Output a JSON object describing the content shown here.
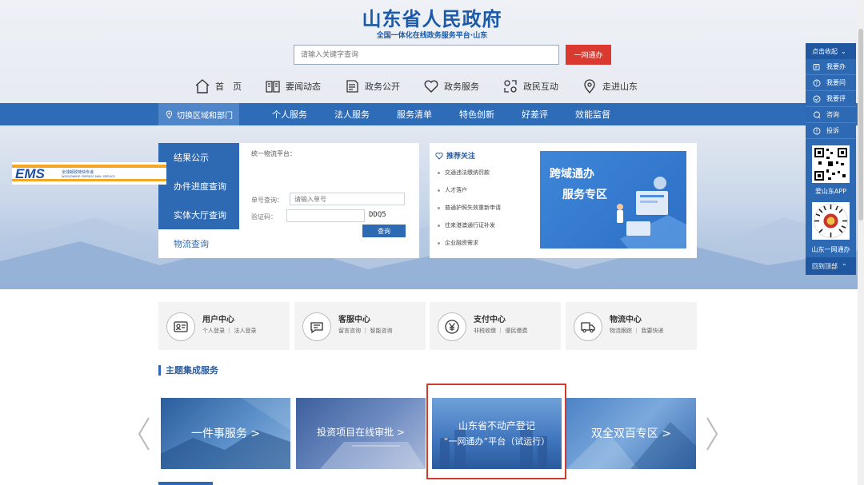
{
  "site": {
    "title": "山东省人民政府",
    "subtitle": "全国一体化在线政务服务平台·山东",
    "search_placeholder": "请输入关键字查询",
    "search_button": "一网通办"
  },
  "top_nav": [
    {
      "label": "首　页",
      "icon": "home-icon"
    },
    {
      "label": "要闻动态",
      "icon": "book-icon"
    },
    {
      "label": "政务公开",
      "icon": "document-icon"
    },
    {
      "label": "政务服务",
      "icon": "heart-icon"
    },
    {
      "label": "政民互动",
      "icon": "interact-icon"
    },
    {
      "label": "走进山东",
      "icon": "location-icon"
    }
  ],
  "region_switch": "切换区域和部门",
  "main_nav": [
    "个人服务",
    "法人服务",
    "服务清单",
    "特色创新",
    "好差评",
    "效能监督"
  ],
  "service_tabs": [
    {
      "label": "结果公示",
      "active": false
    },
    {
      "label": "办件进度查询",
      "active": false
    },
    {
      "label": "实体大厅查询",
      "active": false
    },
    {
      "label": "物流查询",
      "active": true
    }
  ],
  "logistics": {
    "platform_label": "统一物流平台：",
    "ems_logo_text": "EMS",
    "ems_cn": "全球邮政特快专递",
    "ems_en": "WORLDWIDE EXPRESS MAIL SERVICE",
    "order_label": "单号查询：",
    "order_placeholder": "请输入单号",
    "captcha_label": "验证码：",
    "captcha_value": "DDQ5",
    "query_button": "查询"
  },
  "recommend": {
    "title": "推荐关注",
    "items": [
      "交通违法缴纳罚款",
      "人才落户",
      "普通护照失效重新申请",
      "往来港澳通行证补发",
      "企业融资需求"
    ]
  },
  "cross_region": {
    "line1": "跨域通办",
    "line2": "服务专区"
  },
  "sidebar": {
    "header": "点击收起",
    "items": [
      {
        "label": "我要办",
        "icon": "handle-icon"
      },
      {
        "label": "我要问",
        "icon": "question-icon"
      },
      {
        "label": "我要评",
        "icon": "check-icon"
      },
      {
        "label": "咨询",
        "icon": "chat-icon"
      },
      {
        "label": "投诉",
        "icon": "info-icon"
      }
    ],
    "app_label": "爱山东APP",
    "wechat_label": "山东一网通办",
    "back_top": "回到顶部"
  },
  "centers": [
    {
      "name": "用户中心",
      "links": "个人登录 ｜ 法人登录",
      "icon": "id-card-icon"
    },
    {
      "name": "客服中心",
      "links": "留言咨询 ｜ 智能咨询",
      "icon": "chat-bubble-icon"
    },
    {
      "name": "支付中心",
      "links": "非税收缴 ｜ 便民缴费",
      "icon": "yen-icon"
    },
    {
      "name": "物流中心",
      "links": "物流跟踪 ｜ 我要快递",
      "icon": "truck-icon"
    }
  ],
  "theme_section_title": "主题集成服务",
  "banners": [
    {
      "text": "一件事服务 >"
    },
    {
      "text": "投资项目在线审批 >"
    },
    {
      "line1": "山东省不动产登记",
      "line2": "“一网通办”平台（试运行）"
    },
    {
      "text": "双全双百专区 >"
    }
  ],
  "colors": {
    "primary_blue": "#2f6cb8",
    "title_blue": "#1b5aa8",
    "search_red": "#d9392e",
    "highlight_red": "#d33a2e"
  }
}
